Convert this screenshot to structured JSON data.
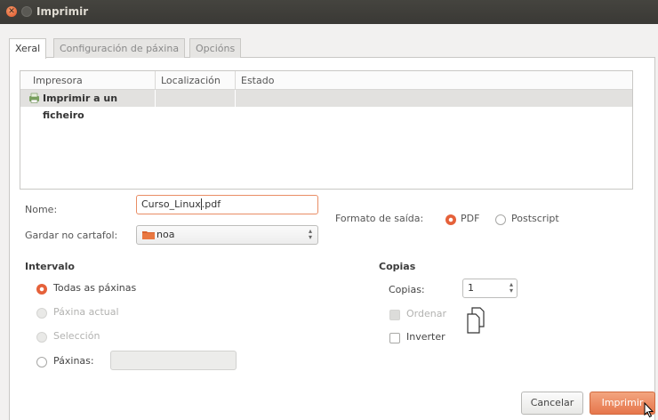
{
  "window": {
    "title": "Imprimir"
  },
  "tabs": [
    {
      "label": "Xeral"
    },
    {
      "label": "Configuración de páxina"
    },
    {
      "label": "Opcións"
    }
  ],
  "printers": {
    "columns": [
      "Impresora",
      "Localización",
      "Estado"
    ],
    "rows": [
      {
        "name": "Imprimir a un ficheiro",
        "location": "",
        "status": ""
      }
    ]
  },
  "file": {
    "name_label": "Nome:",
    "name_value_before_cursor": "Curso_Linux",
    "name_value_after_cursor": ".pdf",
    "folder_label": "Gardar no cartafol:",
    "folder_value": "noa"
  },
  "output_format": {
    "label": "Formato de saída:",
    "options": [
      "PDF",
      "Postscript"
    ],
    "selected": "PDF"
  },
  "range": {
    "title": "Intervalo",
    "all_pages": "Todas as páxinas",
    "current_page": "Páxina actual",
    "selection": "Selección",
    "pages": "Páxinas:",
    "pages_value": ""
  },
  "copies": {
    "title": "Copias",
    "label": "Copias:",
    "value": "1",
    "collate": "Ordenar",
    "reverse": "Inverter"
  },
  "buttons": {
    "cancel": "Cancelar",
    "print": "Imprimir"
  },
  "colors": {
    "accent": "#e5613a",
    "titlebar": "#3a3935"
  }
}
